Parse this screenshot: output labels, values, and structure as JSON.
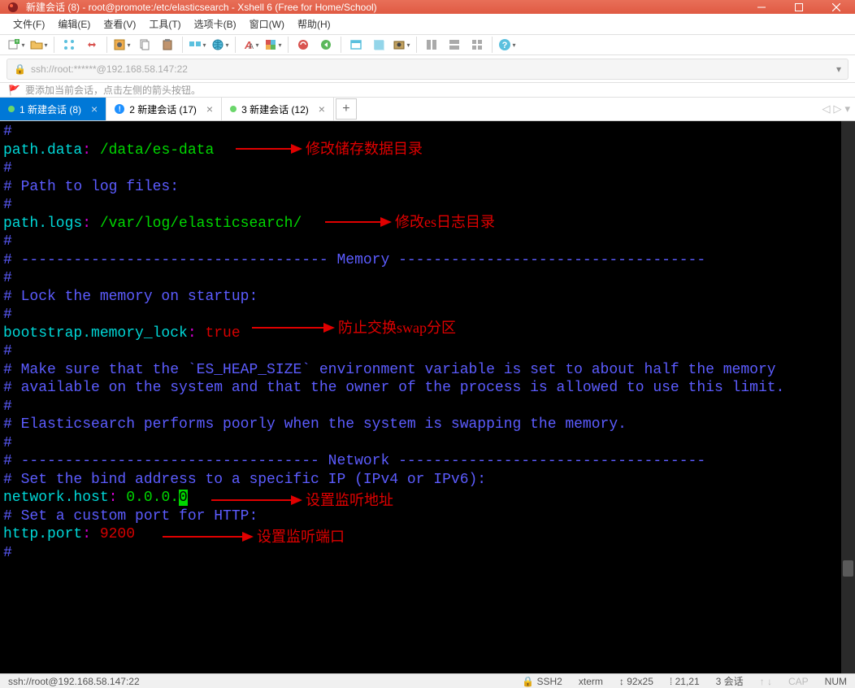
{
  "window": {
    "title": "新建会话 (8) - root@promote:/etc/elasticsearch - Xshell 6 (Free for Home/School)"
  },
  "menu": {
    "file": "文件(F)",
    "edit": "编辑(E)",
    "view": "查看(V)",
    "tools": "工具(T)",
    "tabs": "选项卡(B)",
    "window": "窗口(W)",
    "help": "帮助(H)"
  },
  "address": {
    "text": "ssh://root:******@192.168.58.147:22"
  },
  "hint": {
    "text": "要添加当前会话，点击左侧的箭头按钮。"
  },
  "tabs": {
    "t1": "1 新建会话 (8)",
    "t2": "2 新建会话 (17)",
    "t3": "3 新建会话 (12)",
    "add": "+"
  },
  "terminal": {
    "lines": {
      "hash": "#",
      "path_data_key": "path.data",
      "colon_sp": ": ",
      "path_data_val": "/data/es-data",
      "path_to_log": "# Path to log files:",
      "path_logs_key": "path.logs",
      "path_logs_val": "/var/log/elasticsearch/",
      "memory_header": "# ----------------------------------- Memory -----------------------------------",
      "lock_mem": "# Lock the memory on startup:",
      "bootstrap_key": "bootstrap.memory_lock",
      "bootstrap_val": "true",
      "heap1": "# Make sure that the `ES_HEAP_SIZE` environment variable is set to about half the memory",
      "heap2": "# available on the system and that the owner of the process is allowed to use this limit.",
      "swap": "# Elasticsearch performs poorly when the system is swapping the memory.",
      "network_header": "# ---------------------------------- Network -----------------------------------",
      "bind_addr": "# Set the bind address to a specific IP (IPv4 or IPv6):",
      "network_host_key": "network.host",
      "network_host_val": "0.0.0.0",
      "network_host_val_pre": "0.0.0.",
      "network_host_val_cur": "0",
      "custom_port": "# Set a custom port for HTTP:",
      "http_port_key": "http.port",
      "http_port_val": "9200"
    },
    "annotations": {
      "a1": "修改储存数据目录",
      "a2": "修改es日志目录",
      "a3": "防止交换swap分区",
      "a4": "设置监听地址",
      "a5": "设置监听端口"
    }
  },
  "status": {
    "left": "ssh://root@192.168.58.147:22",
    "proto": "SSH2",
    "term": "xterm",
    "size": "92x25",
    "pos": "21,21",
    "sessions": "3 会话",
    "cap": "CAP",
    "num": "NUM"
  },
  "icon_names": {
    "new": "new-session",
    "open": "open",
    "broadcast": "broadcast",
    "disconnect": "disconnect",
    "properties": "properties",
    "copy": "copy",
    "paste": "paste",
    "find": "find",
    "globe": "globe",
    "font": "font",
    "color": "color-scheme",
    "script1": "script",
    "script2": "script-alt",
    "fullscreen": "fullscreen",
    "transparent": "transparency",
    "capture": "capture",
    "tile1": "tile",
    "tile2": "tile-horiz",
    "tile3": "tile-cascade",
    "help": "help"
  }
}
